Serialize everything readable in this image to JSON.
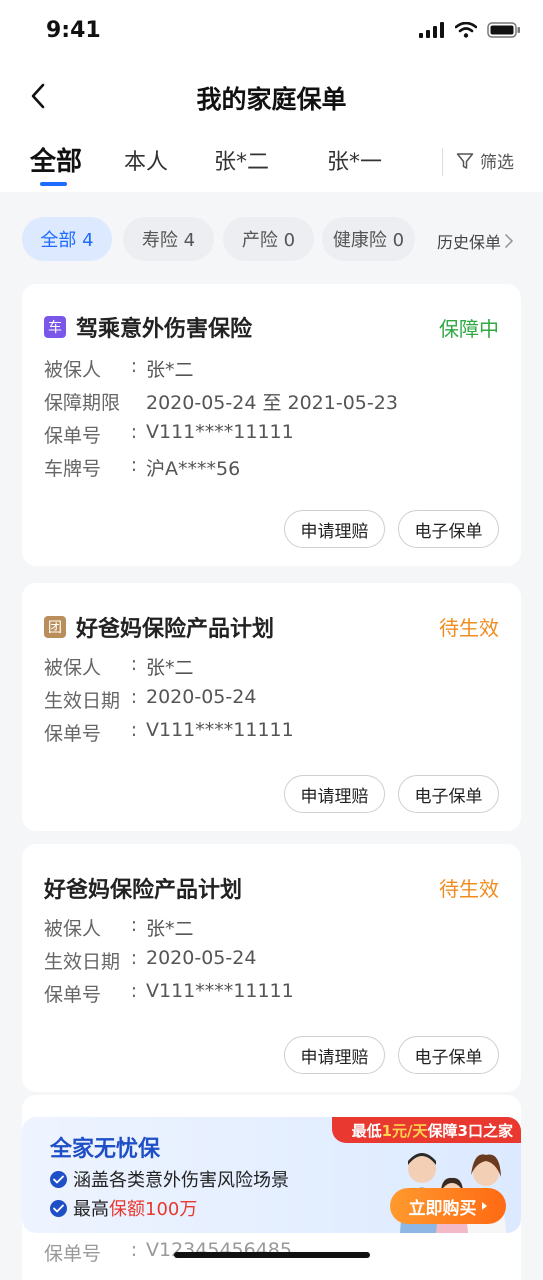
{
  "status_bar": {
    "time": "9:41"
  },
  "nav": {
    "title": "我的家庭保单"
  },
  "tabs": [
    {
      "label": "全部"
    },
    {
      "label": "本人"
    },
    {
      "label": "张*二"
    },
    {
      "label": "张*一"
    }
  ],
  "filter": {
    "label": "筛选"
  },
  "chips": [
    {
      "label": "全部 4"
    },
    {
      "label": "寿险 4"
    },
    {
      "label": "产险 0"
    },
    {
      "label": "健康险 0"
    }
  ],
  "history": {
    "label": "历史保单"
  },
  "policies": [
    {
      "badge": "车",
      "title": "驾乘意外伤害保险",
      "status": "保障中",
      "status_color": "#2fa944",
      "rows": [
        {
          "k": "被保人",
          "v": "张*二"
        },
        {
          "k": "保障期限",
          "v": "2020-05-24 至 2021-05-23"
        },
        {
          "k": "保单号",
          "v": "V111****11111"
        },
        {
          "k": "车牌号",
          "v": "沪A****56"
        }
      ],
      "btn_claim": "申请理赔",
      "btn_epolicy": "电子保单"
    },
    {
      "badge": "团",
      "title": "好爸妈保险产品计划",
      "status": "待生效",
      "status_color": "#f08c1f",
      "rows": [
        {
          "k": "被保人",
          "v": "张*二"
        },
        {
          "k": "生效日期",
          "v": "2020-05-24"
        },
        {
          "k": "保单号",
          "v": "V111****11111"
        }
      ],
      "btn_claim": "申请理赔",
      "btn_epolicy": "电子保单"
    },
    {
      "title": "好爸妈保险产品计划",
      "status": "待生效",
      "status_color": "#f08c1f",
      "rows": [
        {
          "k": "被保人",
          "v": "张*二"
        },
        {
          "k": "生效日期",
          "v": "2020-05-24"
        },
        {
          "k": "保单号",
          "v": "V111****11111"
        }
      ],
      "btn_claim": "申请理赔",
      "btn_epolicy": "电子保单"
    }
  ],
  "peek_row": {
    "k": "保单号",
    "v": "V12345456485"
  },
  "banner": {
    "title": "全家无忧保",
    "item1": "涵盖各类意外伤害风险场景",
    "item2_prefix": "最高",
    "item2_highlight": "保额100万",
    "tag_prefix": "最低",
    "tag_highlight": "1元/天",
    "tag_suffix": "保障3口之家",
    "buy_label": "立即购买"
  }
}
